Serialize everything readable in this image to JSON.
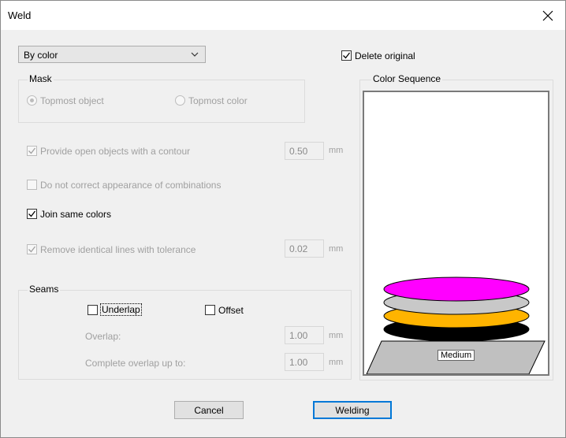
{
  "window": {
    "title": "Weld"
  },
  "mode_select": {
    "value": "By color"
  },
  "delete_original": {
    "label": "Delete original",
    "checked": true
  },
  "mask": {
    "title": "Mask",
    "options": [
      {
        "label": "Topmost object",
        "selected": true,
        "enabled": false
      },
      {
        "label": "Topmost color",
        "selected": false,
        "enabled": false
      }
    ]
  },
  "contour": {
    "label": "Provide open objects with a contour",
    "checked": true,
    "enabled": false,
    "value": "0.50",
    "unit": "mm"
  },
  "no_correct": {
    "label": "Do not correct appearance of combinations",
    "checked": false,
    "enabled": false
  },
  "join_colors": {
    "label": "Join same colors",
    "checked": true
  },
  "remove_lines": {
    "label": "Remove identical lines with tolerance",
    "checked": true,
    "enabled": false,
    "value": "0.02",
    "unit": "mm"
  },
  "seams": {
    "title": "Seams",
    "underlap": {
      "label": "Underlap",
      "checked": false
    },
    "offset": {
      "label": "Offset",
      "checked": false
    },
    "overlap": {
      "label": "Overlap:",
      "value": "1.00",
      "unit": "mm"
    },
    "complete_overlap": {
      "label": "Complete overlap up to:",
      "value": "1.00",
      "unit": "mm"
    }
  },
  "color_sequence": {
    "title": "Color Sequence",
    "medium_label": "Medium",
    "layers": [
      "#ff00ff",
      "#c8c8c8",
      "#ffb400",
      "#000000"
    ]
  },
  "buttons": {
    "cancel": "Cancel",
    "welding": "Welding"
  },
  "icons": {
    "close": "close-icon",
    "dropdown": "chevron-down-icon",
    "check": "checkmark-icon"
  }
}
